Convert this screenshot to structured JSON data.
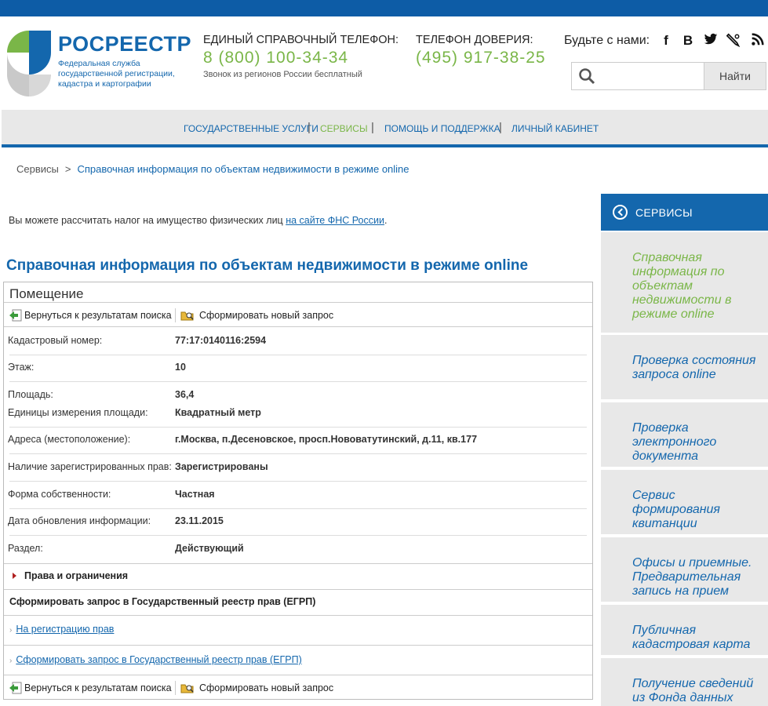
{
  "header": {
    "logo_title": "РОСРЕЕСТР",
    "logo_subtitle": "Федеральная служба государственной регистрации, кадастра и картографии",
    "phone1_label": "ЕДИНЫЙ СПРАВОЧНЫЙ ТЕЛЕФОН:",
    "phone1_number": "8 (800) 100-34-34",
    "phone1_note": "Звонок из регионов России бесплатный",
    "phone2_label": "ТЕЛЕФОН ДОВЕРИЯ:",
    "phone2_number": "(495) 917-38-25",
    "social_label": "Будьте с нами:",
    "social_icons": [
      "facebook-icon",
      "vkontakte-icon",
      "twitter-icon",
      "livejournal-icon",
      "rss-icon"
    ],
    "search_placeholder": "",
    "search_button": "Найти"
  },
  "nav": {
    "items": [
      {
        "label": "ГОСУДАРСТВЕННЫЕ УСЛУГИ",
        "active": false
      },
      {
        "label": "СЕРВИСЫ",
        "active": true
      },
      {
        "label": "ПОМОЩЬ И ПОДДЕРЖКА",
        "active": false
      },
      {
        "label": "ЛИЧНЫЙ КАБИНЕТ",
        "active": false
      }
    ],
    "separator": "|"
  },
  "breadcrumb": {
    "root": "Сервисы",
    "separator": ">",
    "current": "Справочная информация по объектам недвижимости в режиме online"
  },
  "info": {
    "text": "Вы можете рассчитать налог на имущество физических лиц ",
    "link": "на сайте ФНС России",
    "suffix": "."
  },
  "page_title": "Справочная информация по объектам недвижимости в режиме online",
  "panel": {
    "heading": "Помещение",
    "back_label": "Вернуться к результатам поиска",
    "new_request_label": "Сформировать новый запрос",
    "fields": [
      {
        "label": "Кадастровый номер:",
        "value": "77:17:0140116:2594"
      },
      {
        "label": "Этаж:",
        "value": "10"
      },
      {
        "label": "Площадь:",
        "value": "36,4"
      },
      {
        "label": "Единицы измерения площади:",
        "value": "Квадратный метр"
      },
      {
        "label": "Адреса (местоположение):",
        "value": "г.Москва, п.Десеновское, просп.Нововатутинский, д.11, кв.177"
      },
      {
        "label": "Наличие зарегистрированных прав:",
        "value": "Зарегистрированы"
      },
      {
        "label": "Форма собственности:",
        "value": "Частная"
      },
      {
        "label": "Дата обновления информации:",
        "value": "23.11.2015"
      },
      {
        "label": "Раздел:",
        "value": "Действующий"
      }
    ],
    "rights_section": "Права и ограничения",
    "egrp_heading": "Сформировать запрос в Государственный реестр прав (ЕГРП)",
    "link_registration": "На регистрацию прав",
    "link_egrp": "Сформировать запрос в Государственный реестр прав (ЕГРП)"
  },
  "sidebar": {
    "heading": "СЕРВИСЫ",
    "items": [
      {
        "label": "Справочная информация по объектам недвижимости в режиме online",
        "active": true
      },
      {
        "label": "Проверка состояния запроса online",
        "active": false
      },
      {
        "label": "Проверка электронного документа",
        "active": false
      },
      {
        "label": "Сервис формирования квитанции",
        "active": false
      },
      {
        "label": "Офисы и приемные. Предварительная запись на прием",
        "active": false
      },
      {
        "label": "Публичная кадастровая карта",
        "active": false
      },
      {
        "label": "Получение сведений из Фонда данных государственной",
        "active": false
      }
    ]
  },
  "colors": {
    "brand_blue": "#1467ad",
    "accent_green": "#7ab648",
    "top_bar": "#0d5ca6",
    "nav_bg": "#e8e8e8"
  }
}
